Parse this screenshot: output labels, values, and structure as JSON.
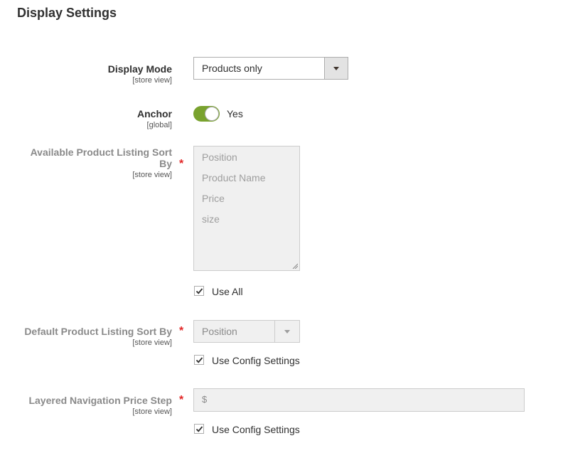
{
  "section": {
    "title": "Display Settings"
  },
  "display_mode": {
    "label": "Display Mode",
    "scope": "[store view]",
    "selected": "Products only"
  },
  "anchor": {
    "label": "Anchor",
    "scope": "[global]",
    "state_text": "Yes",
    "enabled": true
  },
  "available_sort": {
    "label_line1": "Available Product Listing Sort",
    "label_line2": "By",
    "scope": "[store view]",
    "required_mark": "*",
    "options": [
      "Position",
      "Product Name",
      "Price",
      "size"
    ],
    "use_all_label": "Use All",
    "use_all_checked": true
  },
  "default_sort": {
    "label": "Default Product Listing Sort By",
    "scope": "[store view]",
    "required_mark": "*",
    "selected": "Position",
    "use_config_label": "Use Config Settings",
    "use_config_checked": true
  },
  "price_step": {
    "label": "Layered Navigation Price Step",
    "scope": "[store view]",
    "required_mark": "*",
    "currency_symbol": "$",
    "value": "",
    "use_config_label": "Use Config Settings",
    "use_config_checked": true
  },
  "colors": {
    "toggle_on": "#79a22e",
    "required": "#e22626",
    "disabled_bg": "#f0f0f0"
  }
}
